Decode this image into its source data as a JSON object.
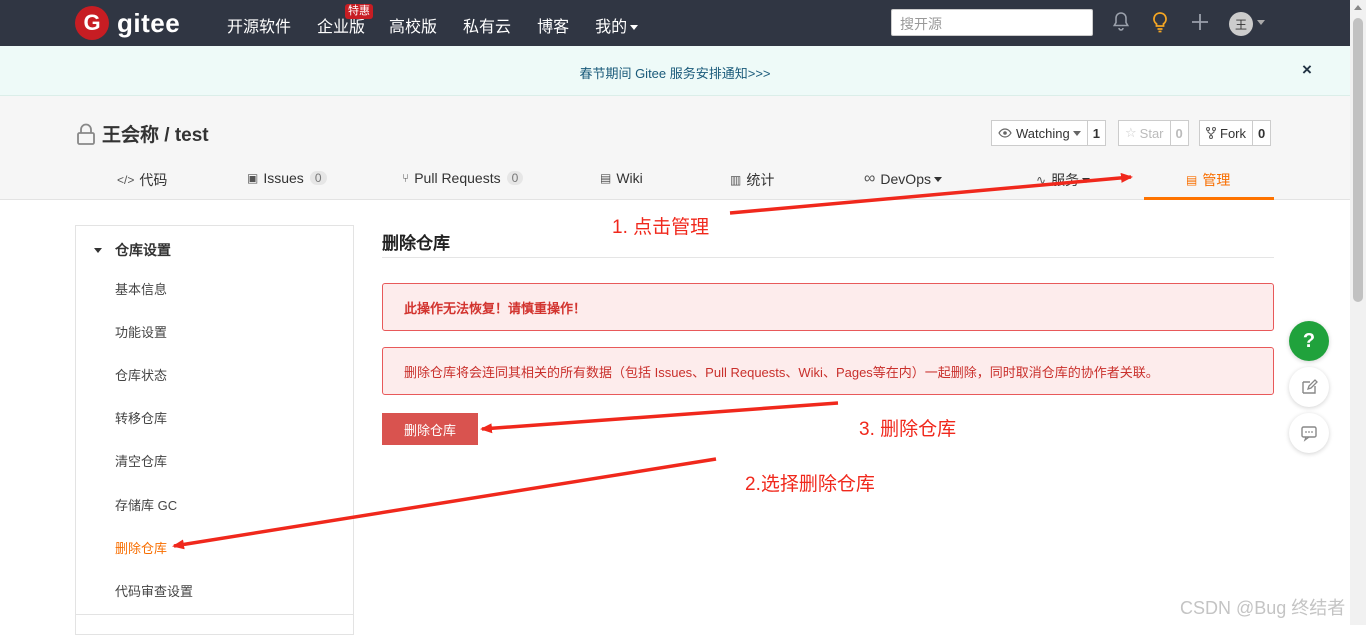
{
  "header": {
    "logo_mark": "G",
    "logo_text": "gitee",
    "nav": [
      "开源软件",
      "企业版",
      "高校版",
      "私有云",
      "博客",
      "我的"
    ],
    "enterprise_badge": "特惠",
    "search_placeholder": "搜开源",
    "avatar_initial": "王"
  },
  "notice": {
    "text": "春节期间 Gitee 服务安排通知>>>",
    "close": "×"
  },
  "repo": {
    "title": "王会称 / test",
    "watching_label": "Watching",
    "watching_count": "1",
    "star_label": "Star",
    "star_count": "0",
    "fork_label": "Fork",
    "fork_count": "0"
  },
  "tabs": {
    "code": "代码",
    "issues": "Issues",
    "issues_count": "0",
    "pr": "Pull Requests",
    "pr_count": "0",
    "wiki": "Wiki",
    "stats": "统计",
    "devops": "DevOps",
    "service": "服务",
    "manage": "管理"
  },
  "sidebar": {
    "section": "仓库设置",
    "items": [
      "基本信息",
      "功能设置",
      "仓库状态",
      "转移仓库",
      "清空仓库",
      "存储库 GC",
      "删除仓库",
      "代码审查设置"
    ]
  },
  "main": {
    "title": "删除仓库",
    "warning": "此操作无法恢复！请慎重操作！",
    "description": "删除仓库将会连同其相关的所有数据（包括 Issues、Pull Requests、Wiki、Pages等在内）一起删除，同时取消仓库的协作者关联。",
    "delete_button": "删除仓库"
  },
  "annotations": {
    "step1": "1. 点击管理",
    "step2": "2.选择删除仓库",
    "step3": "3. 删除仓库"
  },
  "float": {
    "help": "?"
  },
  "watermark": "CSDN @Bug 终结者",
  "colors": {
    "topbar": "#303643",
    "brand_red": "#c71d23",
    "accent_orange": "#f86e00",
    "danger": "#d9534f",
    "annotation_red": "#f0281c",
    "help_green": "#20a23c"
  }
}
